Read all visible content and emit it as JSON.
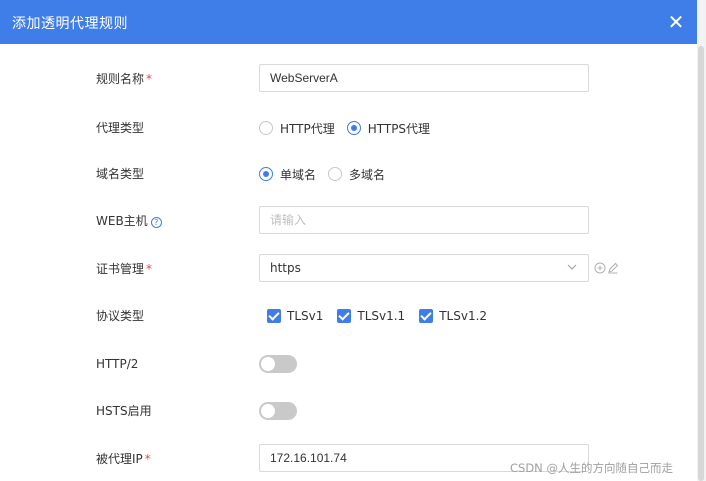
{
  "dialog": {
    "title": "添加透明代理规则",
    "close_glyph": "✕"
  },
  "form": {
    "rule_name": {
      "label": "规则名称",
      "required_mark": "*",
      "value": "WebServerA"
    },
    "proxy_type": {
      "label": "代理类型",
      "options": [
        {
          "label": "HTTP代理",
          "checked": false
        },
        {
          "label": "HTTPS代理",
          "checked": true
        }
      ]
    },
    "domain_type": {
      "label": "域名类型",
      "options": [
        {
          "label": "单域名",
          "checked": true
        },
        {
          "label": "多域名",
          "checked": false
        }
      ]
    },
    "web_host": {
      "label": "WEB主机",
      "help_glyph": "?",
      "placeholder": "请输入"
    },
    "cert_manage": {
      "label": "证书管理",
      "required_mark": "*",
      "value": "https"
    },
    "protocol_type": {
      "label": "协议类型",
      "options": [
        {
          "label": "TLSv1",
          "checked": true
        },
        {
          "label": "TLSv1.1",
          "checked": true
        },
        {
          "label": "TLSv1.2",
          "checked": true
        }
      ]
    },
    "http2": {
      "label": "HTTP/2",
      "enabled": false
    },
    "hsts": {
      "label": "HSTS启用",
      "enabled": false
    },
    "proxied_ip": {
      "label": "被代理IP",
      "required_mark": "*",
      "value": "172.16.101.74"
    }
  },
  "watermark": "CSDN @人生的方向随自己而走",
  "colors": {
    "header": "#3f7de8",
    "accent": "#3f7de8",
    "required": "#e5484d",
    "toggle_off": "#c9c9c9"
  }
}
